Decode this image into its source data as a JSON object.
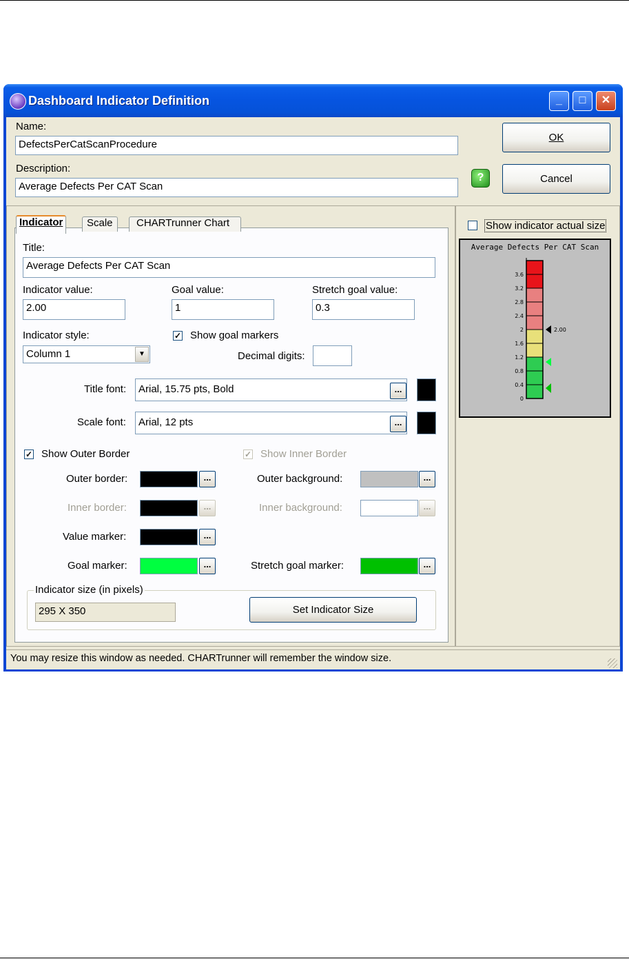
{
  "window": {
    "title": "Dashboard Indicator Definition",
    "controls": [
      "_",
      "□",
      "✕"
    ]
  },
  "name": {
    "label": "Name:",
    "value": "DefectsPerCatScanProcedure"
  },
  "description": {
    "label": "Description:",
    "value": "Average Defects Per CAT Scan"
  },
  "buttons": {
    "ok": "OK",
    "cancel": "Cancel",
    "help_icon": "?"
  },
  "tabs": [
    {
      "label": "Indicator",
      "active": true
    },
    {
      "label": "Scale",
      "active": false
    },
    {
      "label": "CHARTrunner Chart",
      "active": false
    }
  ],
  "form": {
    "title_label": "Title:",
    "title_value": "Average Defects Per CAT Scan",
    "indicator_value_label": "Indicator value:",
    "indicator_value": "2.00",
    "goal_value_label": "Goal value:",
    "goal_value": "1",
    "stretch_goal_label": "Stretch goal value:",
    "stretch_goal_value": "0.3",
    "indicator_style_label": "Indicator style:",
    "indicator_style_value": "Column 1",
    "show_goal_markers_label": "Show goal markers",
    "show_goal_markers_checked": true,
    "decimal_digits_label": "Decimal digits:",
    "decimal_digits_value": "",
    "title_font_label": "Title font:",
    "title_font_value": "Arial, 15.75 pts, Bold",
    "scale_font_label": "Scale font:",
    "scale_font_value": "Arial, 12 pts",
    "dots": "...",
    "show_outer_border_label": "Show Outer Border",
    "show_outer_border_checked": true,
    "show_inner_border_label": "Show Inner Border",
    "show_inner_border_checked": true,
    "outer_border_label": "Outer border:",
    "inner_border_label": "Inner border:",
    "value_marker_label": "Value marker:",
    "goal_marker_label": "Goal marker:",
    "outer_background_label": "Outer background:",
    "inner_background_label": "Inner background:",
    "stretch_goal_marker_label": "Stretch goal marker:",
    "size_group_label": "Indicator size (in pixels)",
    "size_value": "295 X 350",
    "set_size_button": "Set Indicator Size"
  },
  "colors": {
    "title_font": "#000000",
    "scale_font": "#000000",
    "outer_border": "#000000",
    "inner_border": "#000000",
    "value_marker": "#000000",
    "goal_marker": "#00ff40",
    "outer_background": "#c0c0c0",
    "inner_background": "#ffffff",
    "stretch_goal_marker": "#00c000"
  },
  "preview": {
    "show_actual_size_label": "Show indicator actual size",
    "show_actual_size_checked": false,
    "title": "Average Defects Per CAT Scan",
    "ticks": [
      "3.6",
      "3.2",
      "2.8",
      "2.4",
      "2",
      "1.6",
      "1.2",
      "0.8",
      "0.4",
      "0"
    ],
    "value_label": "2.00"
  },
  "chart_data": {
    "type": "bar",
    "title": "Average Defects Per CAT Scan",
    "value": 2.0,
    "goal": 1,
    "stretch_goal": 0.3,
    "ylim": [
      0,
      4
    ],
    "bands": [
      {
        "from": 0,
        "to": 1.2,
        "color": "#2ecc52"
      },
      {
        "from": 1.2,
        "to": 2.0,
        "color": "#e8e07a"
      },
      {
        "from": 2.0,
        "to": 3.2,
        "color": "#e88080"
      },
      {
        "from": 3.2,
        "to": 4.0,
        "color": "#e8141a"
      }
    ]
  },
  "status": "You may resize this window as needed. CHARTrunner will remember the window size."
}
